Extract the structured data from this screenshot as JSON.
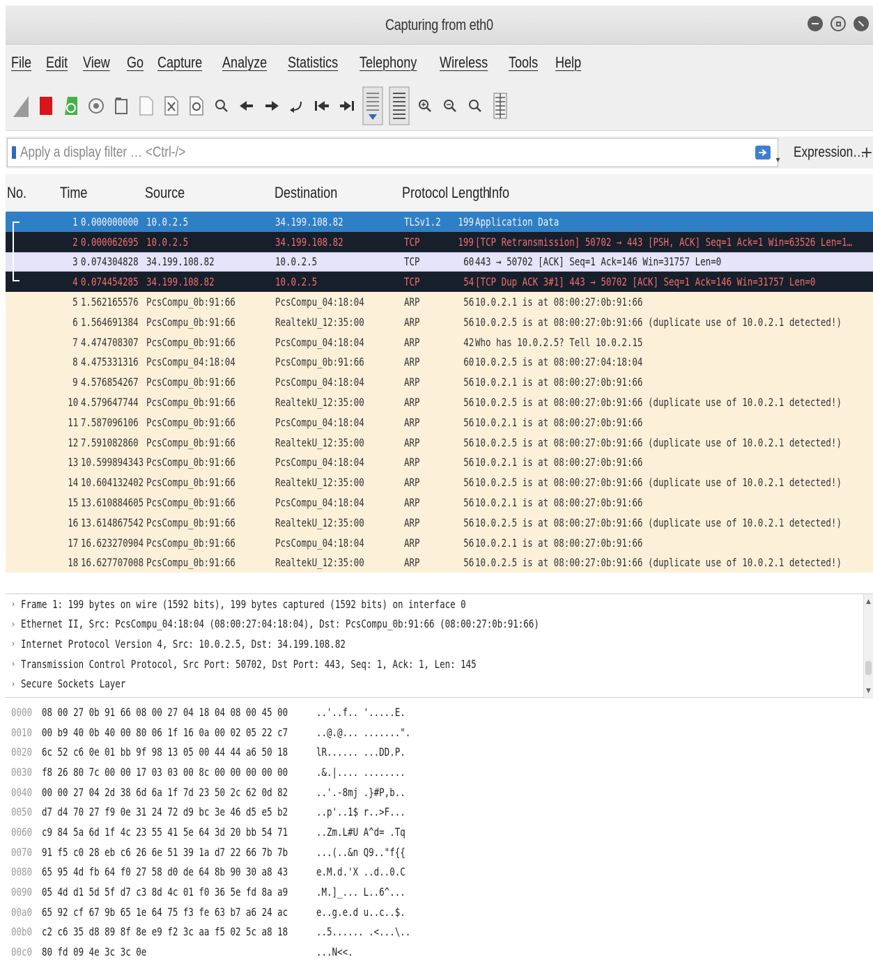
{
  "window": {
    "title": "Capturing from eth0"
  },
  "menu": [
    "File",
    "Edit",
    "View",
    "Go",
    "Capture",
    "Analyze",
    "Statistics",
    "Telephony",
    "Wireless",
    "Tools",
    "Help"
  ],
  "toolbar": {
    "icons": [
      "shark-fin-icon",
      "stop-capture-icon",
      "restart-capture-icon",
      "capture-options-icon",
      "open-file-icon",
      "save-file-icon",
      "close-file-icon",
      "reload-file-icon",
      "find-packet-icon",
      "go-back-icon",
      "go-forward-icon",
      "go-to-packet-icon",
      "go-first-icon",
      "go-last-icon",
      "autoscroll-icon",
      "colorize-icon",
      "zoom-in-icon",
      "zoom-out-icon",
      "zoom-normal-icon",
      "resize-columns-icon"
    ]
  },
  "filter": {
    "placeholder": "Apply a display filter … <Ctrl-/>",
    "expression_label": "Expression…",
    "plus_label": "+"
  },
  "columns": {
    "no": "No.",
    "time": "Time",
    "source": "Source",
    "destination": "Destination",
    "protocol": "Protocol",
    "length": "Length",
    "info": "Info"
  },
  "packets": [
    {
      "no": "1",
      "time": "0.000000000",
      "source": "10.0.2.5",
      "destination": "34.199.108.82",
      "protocol": "TLSv1.2",
      "length": "199",
      "info": "Application Data",
      "style": "sel"
    },
    {
      "no": "2",
      "time": "0.000062695",
      "source": "10.0.2.5",
      "destination": "34.199.108.82",
      "protocol": "TCP",
      "length": "199",
      "info": "[TCP Retransmission] 50702 → 443 [PSH, ACK] Seq=1 Ack=1 Win=63526 Len=1…",
      "style": "dark"
    },
    {
      "no": "3",
      "time": "0.074304828",
      "source": "34.199.108.82",
      "destination": "10.0.2.5",
      "protocol": "TCP",
      "length": "60",
      "info": "443 → 50702 [ACK] Seq=1 Ack=146 Win=31757 Len=0",
      "style": "light"
    },
    {
      "no": "4",
      "time": "0.074454285",
      "source": "34.199.108.82",
      "destination": "10.0.2.5",
      "protocol": "TCP",
      "length": "54",
      "info": "[TCP Dup ACK 3#1] 443 → 50702 [ACK] Seq=1 Ack=146 Win=31757 Len=0",
      "style": "dark"
    },
    {
      "no": "5",
      "time": "1.562165576",
      "source": "PcsCompu_0b:91:66",
      "destination": "PcsCompu_04:18:04",
      "protocol": "ARP",
      "length": "56",
      "info": "10.0.2.1 is at 08:00:27:0b:91:66",
      "style": "arp"
    },
    {
      "no": "6",
      "time": "1.564691384",
      "source": "PcsCompu_0b:91:66",
      "destination": "RealtekU_12:35:00",
      "protocol": "ARP",
      "length": "56",
      "info": "10.0.2.5 is at 08:00:27:0b:91:66 (duplicate use of 10.0.2.1 detected!)",
      "style": "arp"
    },
    {
      "no": "7",
      "time": "4.474708307",
      "source": "PcsCompu_0b:91:66",
      "destination": "PcsCompu_04:18:04",
      "protocol": "ARP",
      "length": "42",
      "info": "Who has 10.0.2.5? Tell 10.0.2.15",
      "style": "arp"
    },
    {
      "no": "8",
      "time": "4.475331316",
      "source": "PcsCompu_04:18:04",
      "destination": "PcsCompu_0b:91:66",
      "protocol": "ARP",
      "length": "60",
      "info": "10.0.2.5 is at 08:00:27:04:18:04",
      "style": "arp"
    },
    {
      "no": "9",
      "time": "4.576854267",
      "source": "PcsCompu_0b:91:66",
      "destination": "PcsCompu_04:18:04",
      "protocol": "ARP",
      "length": "56",
      "info": "10.0.2.1 is at 08:00:27:0b:91:66",
      "style": "arp"
    },
    {
      "no": "10",
      "time": "4.579647744",
      "source": "PcsCompu_0b:91:66",
      "destination": "RealtekU_12:35:00",
      "protocol": "ARP",
      "length": "56",
      "info": "10.0.2.5 is at 08:00:27:0b:91:66 (duplicate use of 10.0.2.1 detected!)",
      "style": "arp"
    },
    {
      "no": "11",
      "time": "7.587096106",
      "source": "PcsCompu_0b:91:66",
      "destination": "PcsCompu_04:18:04",
      "protocol": "ARP",
      "length": "56",
      "info": "10.0.2.1 is at 08:00:27:0b:91:66",
      "style": "arp"
    },
    {
      "no": "12",
      "time": "7.591082860",
      "source": "PcsCompu_0b:91:66",
      "destination": "RealtekU_12:35:00",
      "protocol": "ARP",
      "length": "56",
      "info": "10.0.2.5 is at 08:00:27:0b:91:66 (duplicate use of 10.0.2.1 detected!)",
      "style": "arp"
    },
    {
      "no": "13",
      "time": "10.599894343",
      "source": "PcsCompu_0b:91:66",
      "destination": "PcsCompu_04:18:04",
      "protocol": "ARP",
      "length": "56",
      "info": "10.0.2.1 is at 08:00:27:0b:91:66",
      "style": "arp"
    },
    {
      "no": "14",
      "time": "10.604132402",
      "source": "PcsCompu_0b:91:66",
      "destination": "RealtekU_12:35:00",
      "protocol": "ARP",
      "length": "56",
      "info": "10.0.2.5 is at 08:00:27:0b:91:66 (duplicate use of 10.0.2.1 detected!)",
      "style": "arp"
    },
    {
      "no": "15",
      "time": "13.610884605",
      "source": "PcsCompu_0b:91:66",
      "destination": "PcsCompu_04:18:04",
      "protocol": "ARP",
      "length": "56",
      "info": "10.0.2.1 is at 08:00:27:0b:91:66",
      "style": "arp"
    },
    {
      "no": "16",
      "time": "13.614867542",
      "source": "PcsCompu_0b:91:66",
      "destination": "RealtekU_12:35:00",
      "protocol": "ARP",
      "length": "56",
      "info": "10.0.2.5 is at 08:00:27:0b:91:66 (duplicate use of 10.0.2.1 detected!)",
      "style": "arp"
    },
    {
      "no": "17",
      "time": "16.623270904",
      "source": "PcsCompu_0b:91:66",
      "destination": "PcsCompu_04:18:04",
      "protocol": "ARP",
      "length": "56",
      "info": "10.0.2.1 is at 08:00:27:0b:91:66",
      "style": "arp"
    },
    {
      "no": "18",
      "time": "16.627707008",
      "source": "PcsCompu_0b:91:66",
      "destination": "RealtekU_12:35:00",
      "protocol": "ARP",
      "length": "56",
      "info": "10.0.2.5 is at 08:00:27:0b:91:66 (duplicate use of 10.0.2.1 detected!)",
      "style": "arp"
    }
  ],
  "details": [
    "Frame 1: 199 bytes on wire (1592 bits), 199 bytes captured (1592 bits) on interface 0",
    "Ethernet II, Src: PcsCompu_04:18:04 (08:00:27:04:18:04), Dst: PcsCompu_0b:91:66 (08:00:27:0b:91:66)",
    "Internet Protocol Version 4, Src: 10.0.2.5, Dst: 34.199.108.82",
    "Transmission Control Protocol, Src Port: 50702, Dst Port: 443, Seq: 1, Ack: 1, Len: 145",
    "Secure Sockets Layer"
  ],
  "hex": [
    {
      "offset": "0000",
      "bytes": "08 00 27 0b 91 66 08 00  27 04 18 04 08 00 45 00",
      "ascii": "..'..f.. '.....E."
    },
    {
      "offset": "0010",
      "bytes": "00 b9 40 0b 40 00 80 06  1f 16 0a 00 02 05 22 c7",
      "ascii": "..@.@... .......\"."
    },
    {
      "offset": "0020",
      "bytes": "6c 52 c6 0e 01 bb 9f 98  13 05 00 44 44 a6 50 18",
      "ascii": "lR...... ...DD.P."
    },
    {
      "offset": "0030",
      "bytes": "f8 26 80 7c 00 00 17 03  03 00 8c 00 00 00 00 00",
      "ascii": ".&.|.... ........"
    },
    {
      "offset": "0040",
      "bytes": "00 00 27 04 2d 38 6d 6a  1f 7d 23 50 2c 62 0d 82",
      "ascii": "..'.-8mj .}#P,b.."
    },
    {
      "offset": "0050",
      "bytes": "d7 d4 70 27 f9 0e 31 24  72 d9 bc 3e 46 d5 e5 b2",
      "ascii": "..p'..1$ r..>F..."
    },
    {
      "offset": "0060",
      "bytes": "c9 84 5a 6d 1f 4c 23 55  41 5e 64 3d 20 bb 54 71",
      "ascii": "..Zm.L#U A^d= .Tq"
    },
    {
      "offset": "0070",
      "bytes": "91 f5 c0 28 eb c6 26 6e  51 39 1a d7 22 66 7b 7b",
      "ascii": "...(..&n Q9..\"f{{"
    },
    {
      "offset": "0080",
      "bytes": "65 95 4d fb 64 f0 27 58  d0 de 64 8b 90 30 a8 43",
      "ascii": "e.M.d.'X ..d..0.C"
    },
    {
      "offset": "0090",
      "bytes": "05 4d d1 5d 5f d7 c3 8d  4c 01 f0 36 5e fd 8a a9",
      "ascii": ".M.]_... L..6^..."
    },
    {
      "offset": "00a0",
      "bytes": "65 92 cf 67 9b 65 1e 64  75 f3 fe 63 b7 a6 24 ac",
      "ascii": "e..g.e.d u..c..$."
    },
    {
      "offset": "00b0",
      "bytes": "c2 c6 35 d8 89 8f 8e e9  f2 3c aa f5 02 5c a8 18",
      "ascii": "..5...... .<...\\.."
    },
    {
      "offset": "00c0",
      "bytes": "80 fd 09 4e 3c 3c 0e",
      "ascii": "...N<<."
    }
  ],
  "colors": {
    "selected_row": "#2f7fc6",
    "dark_row": "#171f2b",
    "dark_row_text": "#ef6e6e",
    "light_row": "#e6e4f8",
    "arp_row": "#fcf0d9",
    "filter_bookmark": "#2f6ab8"
  }
}
